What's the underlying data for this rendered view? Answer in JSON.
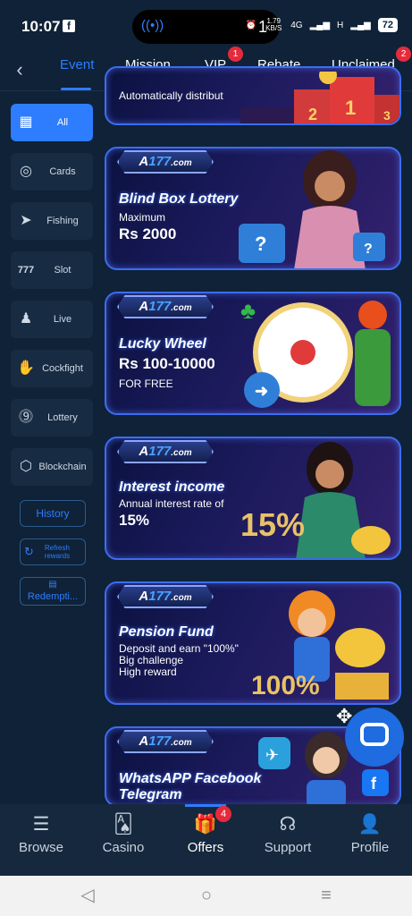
{
  "status": {
    "time": "10:07",
    "app_icon": "f",
    "island_count": "1",
    "net_speed": "1.79 KB/S",
    "net_4g": "4G",
    "net_h": "H",
    "battery": "72"
  },
  "tabs": {
    "items": [
      {
        "label": "Event"
      },
      {
        "label": "Mission"
      },
      {
        "label": "VIP",
        "badge": "1"
      },
      {
        "label": "Rebate"
      },
      {
        "label": "Unclaimed",
        "badge": "2"
      }
    ]
  },
  "sidebar": {
    "items": [
      {
        "label": "All",
        "icon": "grid-icon"
      },
      {
        "label": "Cards",
        "icon": "chip-icon"
      },
      {
        "label": "Fishing",
        "icon": "fish-icon"
      },
      {
        "label": "Slot",
        "icon": "slot-777-icon"
      },
      {
        "label": "Live",
        "icon": "live-icon"
      },
      {
        "label": "Cockfight",
        "icon": "rooster-icon"
      },
      {
        "label": "Lottery",
        "icon": "lottery-ball-icon"
      },
      {
        "label": "Blockchain",
        "icon": "blockchain-icon"
      }
    ],
    "history": "History",
    "refresh": "Refresh rewards",
    "redemption": "Redempti..."
  },
  "banners": {
    "top_partial": {
      "text": "Automatically distribut"
    },
    "blind_box": {
      "logo_a": "A",
      "logo_num": "177",
      "logo_com": ".com",
      "title": "Blind Box Lottery",
      "sub": "Maximum",
      "big": "Rs 2000"
    },
    "lucky_wheel": {
      "logo_a": "A",
      "logo_num": "177",
      "logo_com": ".com",
      "title": "Lucky Wheel",
      "big": "Rs 100-10000",
      "sub": "FOR FREE"
    },
    "interest": {
      "logo_a": "A",
      "logo_num": "177",
      "logo_com": ".com",
      "title": "Interest income",
      "sub": "Annual interest rate of",
      "big": "15%",
      "art_text": "15%"
    },
    "pension": {
      "logo_a": "A",
      "logo_num": "177",
      "logo_com": ".com",
      "title": "Pension Fund",
      "sub1": "Deposit and earn \"100%\"",
      "sub2": "Big challenge",
      "sub3": "High reward",
      "art_text": "100%"
    },
    "social": {
      "logo_a": "A",
      "logo_num": "177",
      "logo_com": ".com",
      "title1": "WhatsAPP Facebook",
      "title2": "Telegram"
    }
  },
  "bottom_nav": {
    "items": [
      {
        "label": "Browse",
        "icon": "search-list-icon"
      },
      {
        "label": "Casino",
        "icon": "cards-icon"
      },
      {
        "label": "Offers",
        "icon": "gift-icon",
        "badge": "4"
      },
      {
        "label": "Support",
        "icon": "headset-icon"
      },
      {
        "label": "Profile",
        "icon": "person-icon"
      }
    ]
  },
  "colors": {
    "accent": "#2e7dff",
    "background": "#0f2237",
    "badge": "#e62a3b"
  }
}
